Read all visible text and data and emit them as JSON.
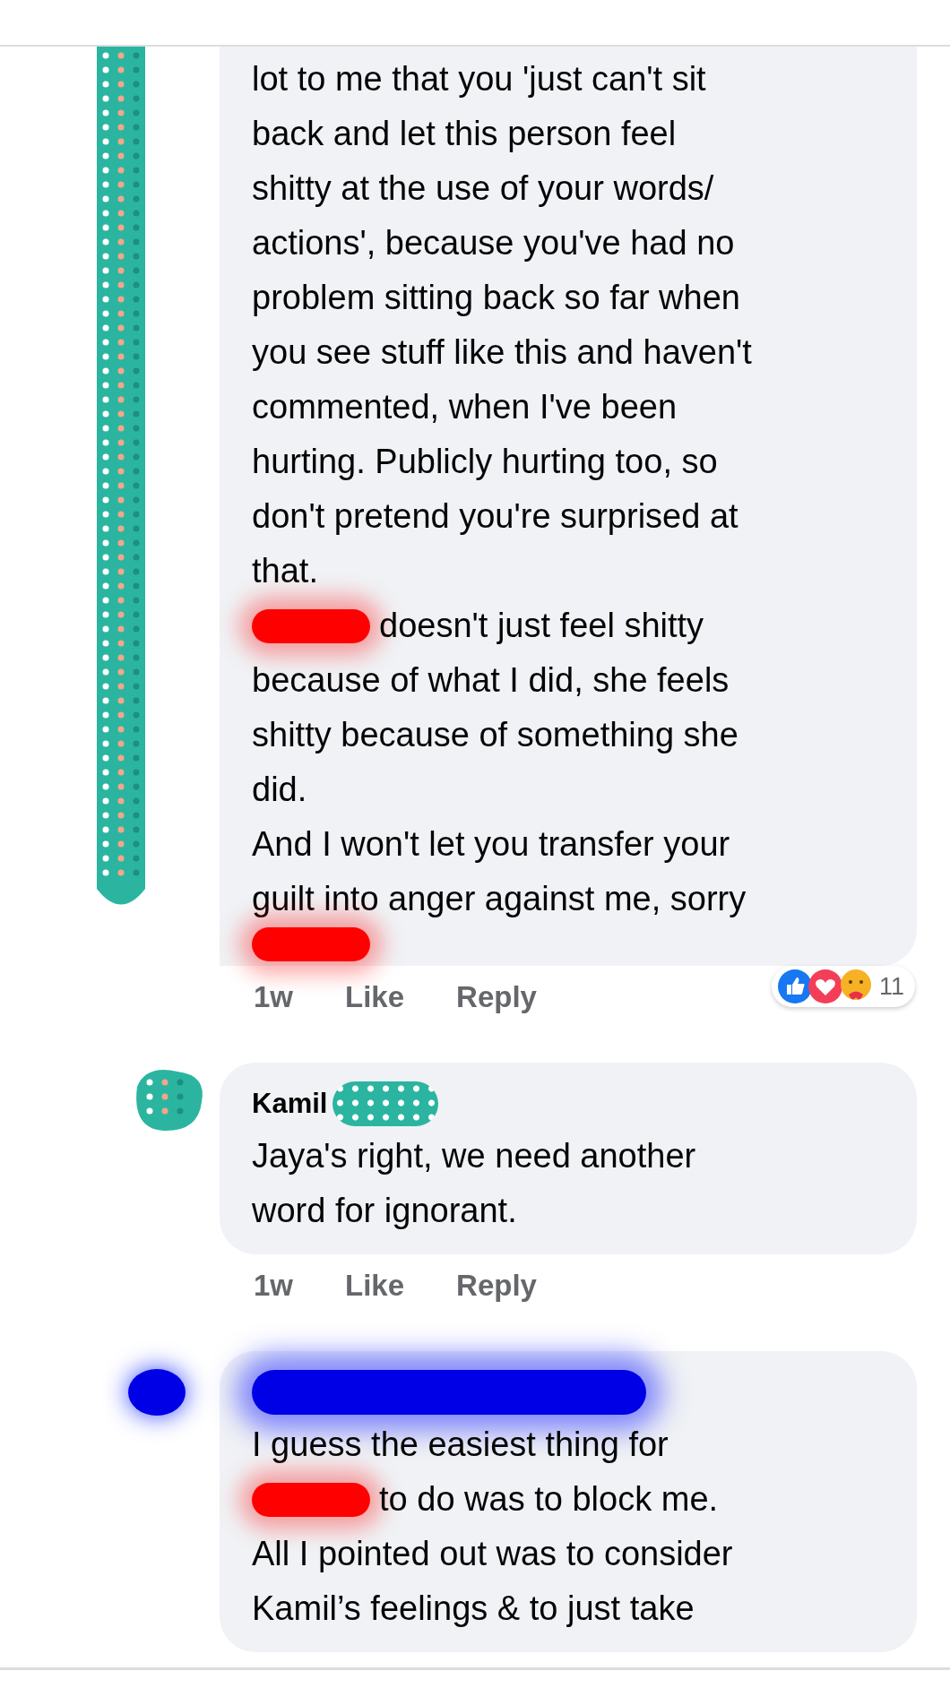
{
  "comments": [
    {
      "avatar": {
        "kind": "teal-strip"
      },
      "top_cut": true,
      "lines": [
        {
          "kind": "text",
          "text": "lot to me that you 'just can't sit"
        },
        {
          "kind": "text",
          "text": "back and let this person feel"
        },
        {
          "kind": "text",
          "text": "shitty at the use of your words/"
        },
        {
          "kind": "text",
          "text": "actions', because you've had no"
        },
        {
          "kind": "text",
          "text": "problem sitting back so far when"
        },
        {
          "kind": "text",
          "text": "you see stuff like this and haven't"
        },
        {
          "kind": "text",
          "text": "commented, when I've been"
        },
        {
          "kind": "text",
          "text": "hurting. Publicly hurting too, so"
        },
        {
          "kind": "text",
          "text": "don't pretend you're surprised at"
        },
        {
          "kind": "text",
          "text": "that."
        },
        {
          "kind": "redacted-prefix",
          "text": "doesn't just feel shitty"
        },
        {
          "kind": "text",
          "text": "because of what I did, she feels"
        },
        {
          "kind": "text",
          "text": "shitty because of something she"
        },
        {
          "kind": "text",
          "text": "did."
        },
        {
          "kind": "text",
          "text": "And I won't let you transfer your"
        },
        {
          "kind": "text",
          "text": "guilt into anger against me, sorry"
        },
        {
          "kind": "redacted"
        }
      ],
      "actions": {
        "time": "1w",
        "like": "Like",
        "reply": "Reply"
      },
      "reactions": {
        "count": "11"
      }
    },
    {
      "avatar": {
        "kind": "teal-blob"
      },
      "name": "Kamil",
      "name_redacted": true,
      "lines": [
        {
          "kind": "text",
          "text": "Jaya's right, we need another"
        },
        {
          "kind": "text",
          "text": "word for ignorant."
        }
      ],
      "actions": {
        "time": "1w",
        "like": "Like",
        "reply": "Reply"
      }
    },
    {
      "avatar": {
        "kind": "blue-blob"
      },
      "name_redacted": true,
      "lines": [
        {
          "kind": "text",
          "text": "I guess the easiest thing for"
        },
        {
          "kind": "redacted-prefix",
          "text": "to do was to block me."
        },
        {
          "kind": "text",
          "text": "All I pointed out was to consider"
        },
        {
          "kind": "text",
          "text": "Kamil’s feelings & to just take"
        }
      ]
    }
  ]
}
